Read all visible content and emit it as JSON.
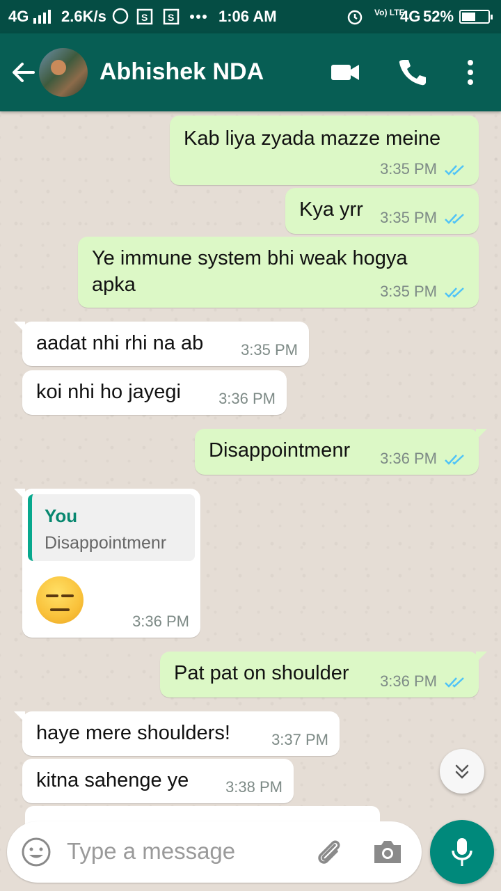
{
  "status_bar": {
    "network_left": "4G",
    "speed": "2.6K/s",
    "time": "1:06 AM",
    "volte": "Vo) LTE",
    "network_right": "4G",
    "battery_percent": "52%",
    "battery_level": 0.52
  },
  "header": {
    "contact_name": "Abhishek NDA"
  },
  "messages": [
    {
      "direction": "out",
      "text": "Kab liya zyada mazze meine",
      "time": "3:35 PM",
      "ticks": "read"
    },
    {
      "direction": "out",
      "text": "Kya yrr",
      "time": "3:35 PM",
      "ticks": "read"
    },
    {
      "direction": "out",
      "text_line1": "Ye immune system bhi weak hogya",
      "text_line2": "apka",
      "time": "3:35 PM",
      "ticks": "read"
    },
    {
      "direction": "in",
      "text": "aadat nhi rhi na ab",
      "time": "3:35 PM"
    },
    {
      "direction": "in",
      "text": "koi nhi ho jayegi",
      "time": "3:36 PM"
    },
    {
      "direction": "out",
      "text": "Disappointmenr",
      "time": "3:36 PM",
      "ticks": "read"
    },
    {
      "direction": "in",
      "quote_name": "You",
      "quote_text": "Disappointmenr",
      "emoji": "expressionless-face",
      "time": "3:36 PM"
    },
    {
      "direction": "out",
      "text": "Pat pat on shoulder",
      "time": "3:36 PM",
      "ticks": "read"
    },
    {
      "direction": "in",
      "text": "haye mere shoulders!",
      "time": "3:37 PM"
    },
    {
      "direction": "in",
      "text": "kitna sahenge ye",
      "time": "3:38 PM"
    }
  ],
  "composer": {
    "placeholder": "Type a message"
  },
  "colors": {
    "header": "#075e54",
    "status_bar": "#054d44",
    "outgoing_bubble": "#dcf8c6",
    "incoming_bubble": "#ffffff",
    "read_ticks": "#4fc3f7",
    "mic_button": "#00897b",
    "quote_accent": "#07a88d"
  },
  "icons": [
    "back-arrow-icon",
    "video-call-icon",
    "phone-icon",
    "more-vert-icon",
    "double-check-icon",
    "chevrons-down-icon",
    "emoji-icon",
    "attach-icon",
    "camera-icon",
    "mic-icon"
  ]
}
